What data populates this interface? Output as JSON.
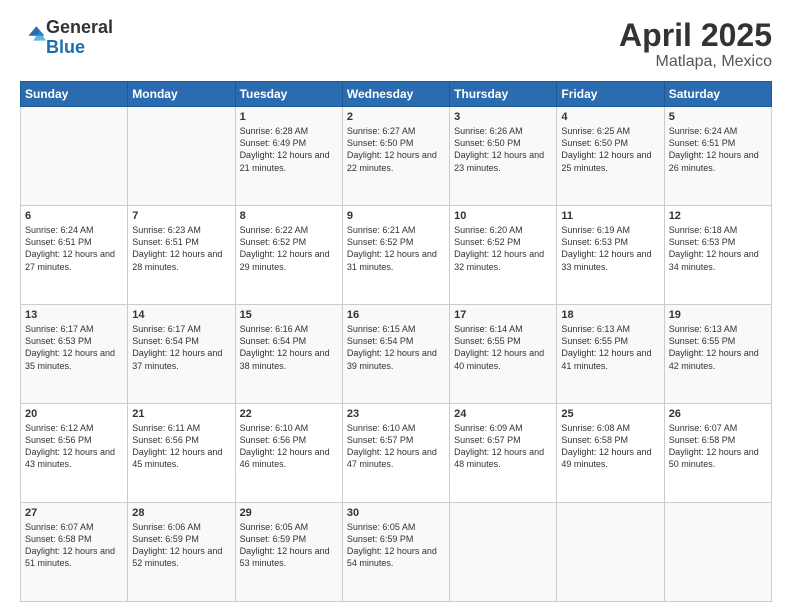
{
  "header": {
    "logo_general": "General",
    "logo_blue": "Blue",
    "title": "April 2025",
    "location": "Matlapa, Mexico"
  },
  "days_of_week": [
    "Sunday",
    "Monday",
    "Tuesday",
    "Wednesday",
    "Thursday",
    "Friday",
    "Saturday"
  ],
  "weeks": [
    [
      {
        "day": "",
        "info": ""
      },
      {
        "day": "",
        "info": ""
      },
      {
        "day": "1",
        "info": "Sunrise: 6:28 AM\nSunset: 6:49 PM\nDaylight: 12 hours and 21 minutes."
      },
      {
        "day": "2",
        "info": "Sunrise: 6:27 AM\nSunset: 6:50 PM\nDaylight: 12 hours and 22 minutes."
      },
      {
        "day": "3",
        "info": "Sunrise: 6:26 AM\nSunset: 6:50 PM\nDaylight: 12 hours and 23 minutes."
      },
      {
        "day": "4",
        "info": "Sunrise: 6:25 AM\nSunset: 6:50 PM\nDaylight: 12 hours and 25 minutes."
      },
      {
        "day": "5",
        "info": "Sunrise: 6:24 AM\nSunset: 6:51 PM\nDaylight: 12 hours and 26 minutes."
      }
    ],
    [
      {
        "day": "6",
        "info": "Sunrise: 6:24 AM\nSunset: 6:51 PM\nDaylight: 12 hours and 27 minutes."
      },
      {
        "day": "7",
        "info": "Sunrise: 6:23 AM\nSunset: 6:51 PM\nDaylight: 12 hours and 28 minutes."
      },
      {
        "day": "8",
        "info": "Sunrise: 6:22 AM\nSunset: 6:52 PM\nDaylight: 12 hours and 29 minutes."
      },
      {
        "day": "9",
        "info": "Sunrise: 6:21 AM\nSunset: 6:52 PM\nDaylight: 12 hours and 31 minutes."
      },
      {
        "day": "10",
        "info": "Sunrise: 6:20 AM\nSunset: 6:52 PM\nDaylight: 12 hours and 32 minutes."
      },
      {
        "day": "11",
        "info": "Sunrise: 6:19 AM\nSunset: 6:53 PM\nDaylight: 12 hours and 33 minutes."
      },
      {
        "day": "12",
        "info": "Sunrise: 6:18 AM\nSunset: 6:53 PM\nDaylight: 12 hours and 34 minutes."
      }
    ],
    [
      {
        "day": "13",
        "info": "Sunrise: 6:17 AM\nSunset: 6:53 PM\nDaylight: 12 hours and 35 minutes."
      },
      {
        "day": "14",
        "info": "Sunrise: 6:17 AM\nSunset: 6:54 PM\nDaylight: 12 hours and 37 minutes."
      },
      {
        "day": "15",
        "info": "Sunrise: 6:16 AM\nSunset: 6:54 PM\nDaylight: 12 hours and 38 minutes."
      },
      {
        "day": "16",
        "info": "Sunrise: 6:15 AM\nSunset: 6:54 PM\nDaylight: 12 hours and 39 minutes."
      },
      {
        "day": "17",
        "info": "Sunrise: 6:14 AM\nSunset: 6:55 PM\nDaylight: 12 hours and 40 minutes."
      },
      {
        "day": "18",
        "info": "Sunrise: 6:13 AM\nSunset: 6:55 PM\nDaylight: 12 hours and 41 minutes."
      },
      {
        "day": "19",
        "info": "Sunrise: 6:13 AM\nSunset: 6:55 PM\nDaylight: 12 hours and 42 minutes."
      }
    ],
    [
      {
        "day": "20",
        "info": "Sunrise: 6:12 AM\nSunset: 6:56 PM\nDaylight: 12 hours and 43 minutes."
      },
      {
        "day": "21",
        "info": "Sunrise: 6:11 AM\nSunset: 6:56 PM\nDaylight: 12 hours and 45 minutes."
      },
      {
        "day": "22",
        "info": "Sunrise: 6:10 AM\nSunset: 6:56 PM\nDaylight: 12 hours and 46 minutes."
      },
      {
        "day": "23",
        "info": "Sunrise: 6:10 AM\nSunset: 6:57 PM\nDaylight: 12 hours and 47 minutes."
      },
      {
        "day": "24",
        "info": "Sunrise: 6:09 AM\nSunset: 6:57 PM\nDaylight: 12 hours and 48 minutes."
      },
      {
        "day": "25",
        "info": "Sunrise: 6:08 AM\nSunset: 6:58 PM\nDaylight: 12 hours and 49 minutes."
      },
      {
        "day": "26",
        "info": "Sunrise: 6:07 AM\nSunset: 6:58 PM\nDaylight: 12 hours and 50 minutes."
      }
    ],
    [
      {
        "day": "27",
        "info": "Sunrise: 6:07 AM\nSunset: 6:58 PM\nDaylight: 12 hours and 51 minutes."
      },
      {
        "day": "28",
        "info": "Sunrise: 6:06 AM\nSunset: 6:59 PM\nDaylight: 12 hours and 52 minutes."
      },
      {
        "day": "29",
        "info": "Sunrise: 6:05 AM\nSunset: 6:59 PM\nDaylight: 12 hours and 53 minutes."
      },
      {
        "day": "30",
        "info": "Sunrise: 6:05 AM\nSunset: 6:59 PM\nDaylight: 12 hours and 54 minutes."
      },
      {
        "day": "",
        "info": ""
      },
      {
        "day": "",
        "info": ""
      },
      {
        "day": "",
        "info": ""
      }
    ]
  ]
}
